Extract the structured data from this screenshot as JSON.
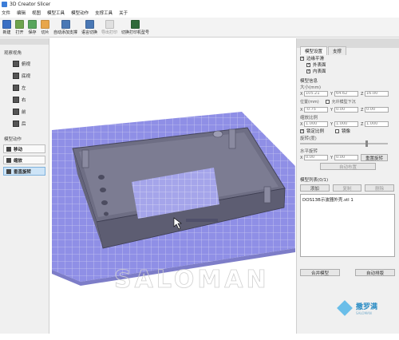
{
  "window": {
    "title": "3D Creator Slicer"
  },
  "menu": [
    "文件",
    "编辑",
    "视图",
    "模型工具",
    "模型动作",
    "支撑工具",
    "关于"
  ],
  "toolbar": [
    {
      "label": "新建",
      "icon": "new-file-icon",
      "color": "#3a6fc4",
      "dim": false
    },
    {
      "label": "打开",
      "icon": "open-folder-icon",
      "color": "#6da34d",
      "dim": false
    },
    {
      "label": "保存",
      "icon": "save-icon",
      "color": "#58a55c",
      "dim": false
    },
    {
      "label": "切片",
      "icon": "slice-icon",
      "color": "#e8a64a",
      "dim": false
    },
    {
      "label": "自动添加支撑",
      "icon": "auto-support-icon",
      "color": "#4a78b5",
      "dim": false
    },
    {
      "label": "语言切换",
      "icon": "language-icon",
      "color": "#4a78b5",
      "dim": false
    },
    {
      "label": "导出打印",
      "icon": "export-print-icon",
      "color": "#bdbdbd",
      "dim": true
    },
    {
      "label": "切换打印机型号",
      "icon": "printer-switch-icon",
      "color": "#2f6a3a",
      "dim": false
    }
  ],
  "left_panel": {
    "view_title": "观察视角",
    "views": [
      "俯视",
      "底视",
      "左",
      "右",
      "前",
      "后"
    ],
    "action_title": "模型动作",
    "actions": [
      {
        "label": "移动",
        "active": false
      },
      {
        "label": "缩放",
        "active": false
      },
      {
        "label": "垂直旋转",
        "active": true
      }
    ]
  },
  "right_panel": {
    "tabs": [
      "模型设置",
      "支撑"
    ],
    "checkboxes": [
      {
        "label": "边缘平滑",
        "checked": true
      },
      {
        "label": "外表面",
        "checked": true
      },
      {
        "label": "内表面",
        "checked": true
      }
    ],
    "info_title": "模型信息",
    "size_label": "大小(mm)",
    "size": {
      "x": "105.21",
      "y": "64.62",
      "z": "16.00"
    },
    "position_label": "位置(mm)",
    "allow_below": "允许模型下沉",
    "position": {
      "x": "-0.75",
      "y": "0.00",
      "z": "0.00"
    },
    "scale_label": "缩放比例",
    "scale": {
      "x": "1.000",
      "y": "1.000",
      "z": "1.000"
    },
    "lock_ratio": "锁定比例",
    "mirror": "镜像",
    "rotate_label": "旋转(度)",
    "horizontal_rotate": "水平旋转",
    "rotate_values": {
      "x": "0.00",
      "y": "0.00"
    },
    "reset_rotate": "重置旋转",
    "auto_layout": "自动布置",
    "list_title": "模型列表(0/1)",
    "list_buttons": [
      "添加",
      "复制",
      "删除"
    ],
    "models": [
      "DOS13B示波器外壳.stl 1"
    ],
    "merge": "合并模型",
    "auto_arrange": "自动排版"
  },
  "watermark": "SALOMAN",
  "logo": {
    "name": "撒罗满",
    "sub": "SALOMAN"
  }
}
